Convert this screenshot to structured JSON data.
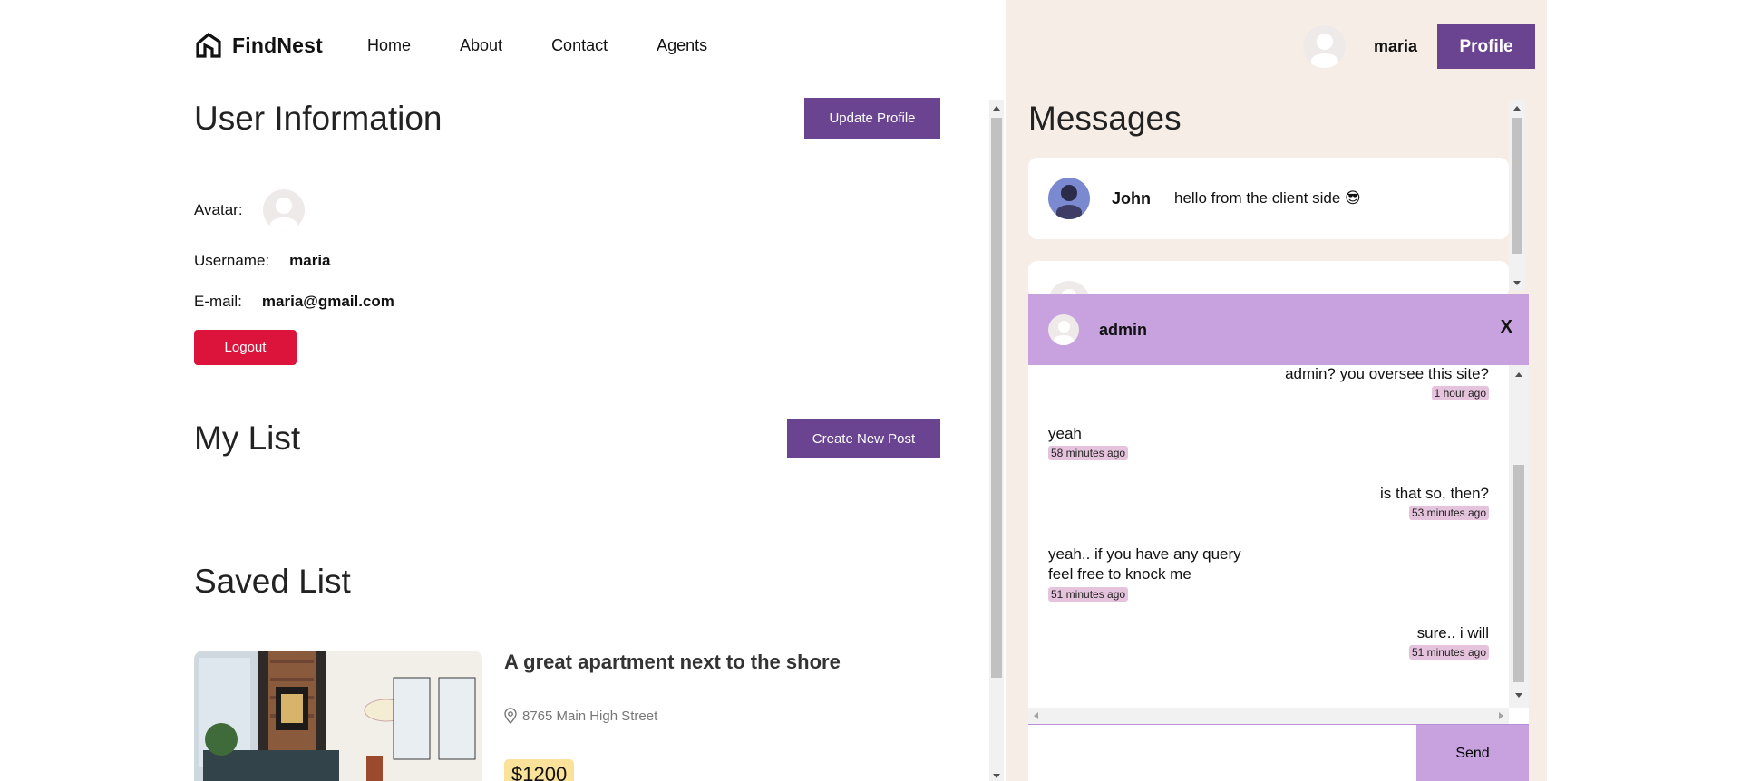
{
  "brand": {
    "name": "FindNest"
  },
  "nav": [
    {
      "label": "Home"
    },
    {
      "label": "About"
    },
    {
      "label": "Contact"
    },
    {
      "label": "Agents"
    }
  ],
  "topbar": {
    "username": "maria",
    "profile_button": "Profile"
  },
  "user_info": {
    "title": "User Information",
    "update_button": "Update Profile",
    "avatar_label": "Avatar:",
    "username_label": "Username:",
    "username": "maria",
    "email_label": "E-mail:",
    "email": "maria@gmail.com",
    "logout_button": "Logout"
  },
  "my_list": {
    "title": "My List",
    "create_button": "Create New Post"
  },
  "saved_list": {
    "title": "Saved List",
    "items": [
      {
        "title": "A great apartment next to the shore",
        "address": "8765 Main High Street",
        "price": "$1200"
      }
    ]
  },
  "messages": {
    "title": "Messages",
    "items": [
      {
        "sender": "John",
        "text": "hello from the client side 😎"
      }
    ]
  },
  "chat": {
    "with": "admin",
    "close_label": "X",
    "messages": [
      {
        "side": "right",
        "text": "admin? you oversee this site?",
        "time": "1 hour ago"
      },
      {
        "side": "left",
        "text": "yeah",
        "time": "58 minutes ago"
      },
      {
        "side": "right",
        "text": "is that so, then?",
        "time": "53 minutes ago"
      },
      {
        "side": "left",
        "text": "yeah.. if you have any query\nfeel free to knock me",
        "time": "51 minutes ago"
      },
      {
        "side": "right",
        "text": "sure.. i will",
        "time": "51 minutes ago"
      }
    ],
    "send_button": "Send"
  },
  "colors": {
    "accent_purple": "#6a4490",
    "chat_purple": "#c7a2df",
    "logout_red": "#dc143c",
    "panel_beige": "#f6eee6",
    "price_yellow": "#fbe29a",
    "time_pink": "#e6c3dd"
  }
}
